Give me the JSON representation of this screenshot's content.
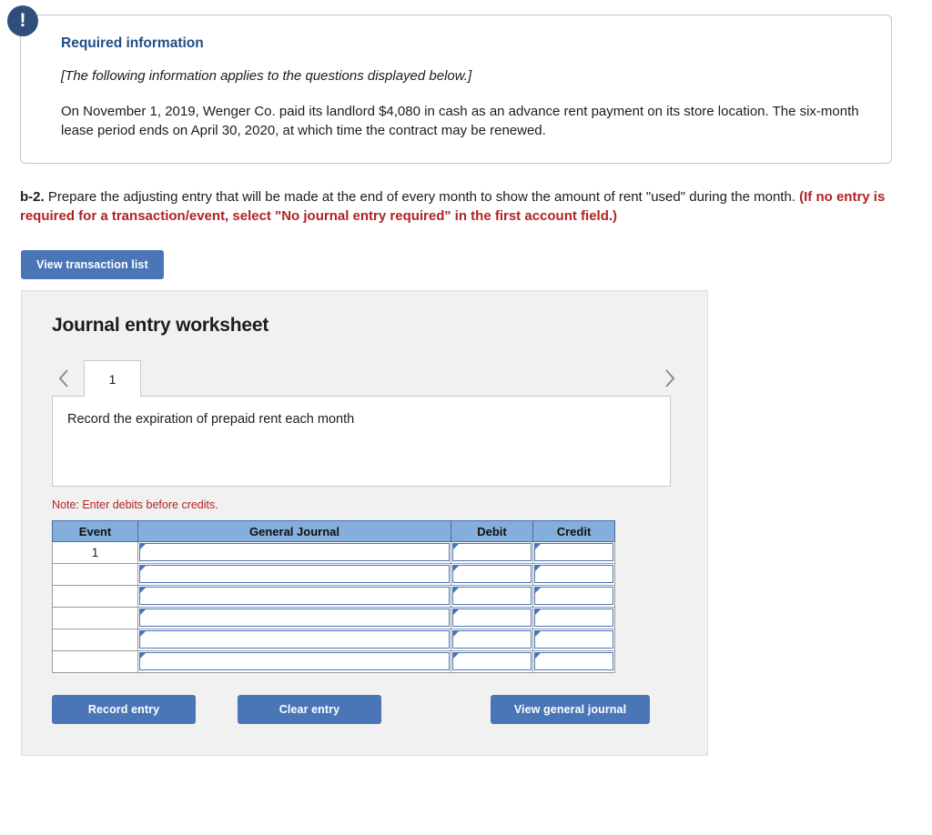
{
  "callout": {
    "icon": "exclamation-icon",
    "title": "Required information",
    "italic_note": "[The following information applies to the questions displayed below.]",
    "body": "On November 1, 2019, Wenger Co. paid its landlord $4,080 in cash as an advance rent payment on its store location. The six-month lease period ends on April 30, 2020, at which time the contract may be renewed."
  },
  "instruction": {
    "label": "b-2.",
    "text": " Prepare the adjusting entry that will be made at the end of every month to show the amount of rent \"used\" during the month. ",
    "requirement": "(If no entry is required for a transaction/event, select \"No journal entry required\" in the first account field.)"
  },
  "buttons": {
    "view_transaction_list": "View transaction list",
    "record_entry": "Record entry",
    "clear_entry": "Clear entry",
    "view_general_journal": "View general journal"
  },
  "worksheet": {
    "title": "Journal entry worksheet",
    "prev_arrow": "chevron-left-icon",
    "next_arrow": "chevron-right-icon",
    "tabs": [
      {
        "label": "1",
        "active": true
      }
    ],
    "tab_description": "Record the expiration of prepaid rent each month",
    "note": "Note: Enter debits before credits."
  },
  "table": {
    "headers": [
      "Event",
      "General Journal",
      "Debit",
      "Credit"
    ],
    "rows": [
      {
        "event": "1",
        "general_journal": "",
        "debit": "",
        "credit": ""
      },
      {
        "event": "",
        "general_journal": "",
        "debit": "",
        "credit": ""
      },
      {
        "event": "",
        "general_journal": "",
        "debit": "",
        "credit": ""
      },
      {
        "event": "",
        "general_journal": "",
        "debit": "",
        "credit": ""
      },
      {
        "event": "",
        "general_journal": "",
        "debit": "",
        "credit": ""
      },
      {
        "event": "",
        "general_journal": "",
        "debit": "",
        "credit": ""
      }
    ]
  },
  "colors": {
    "button_blue": "#4a76b8",
    "header_blue": "#84aedc",
    "heading_navy": "#1f4e89",
    "badge_navy": "#2e4f7c",
    "warning_red": "#b22222",
    "panel_gray": "#f1f1f1"
  }
}
